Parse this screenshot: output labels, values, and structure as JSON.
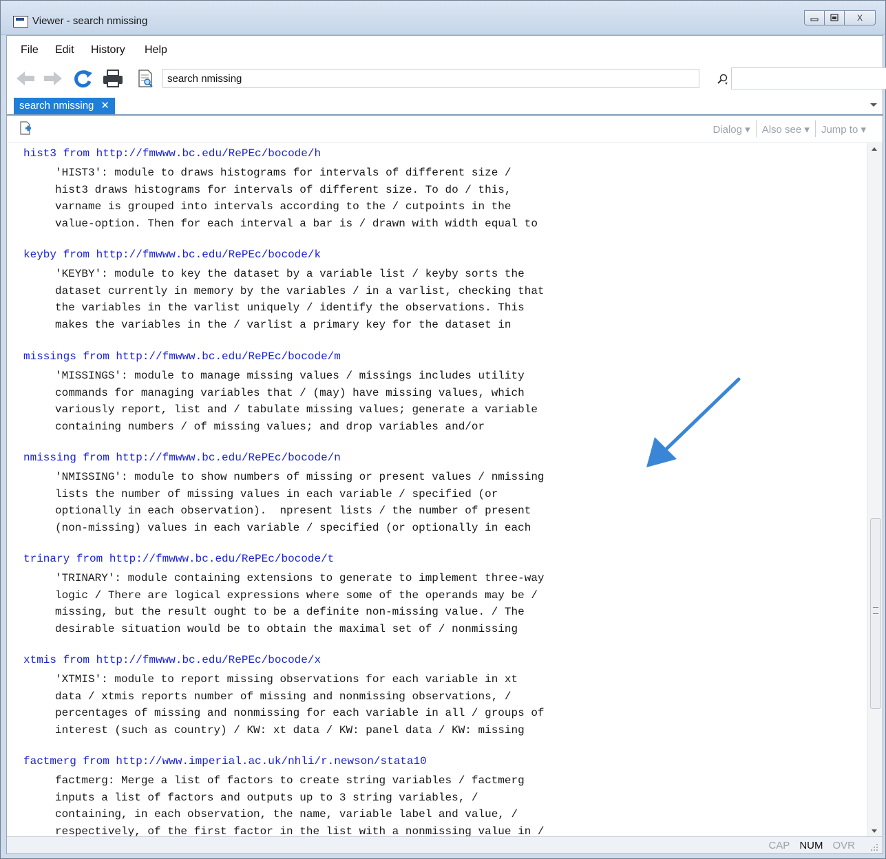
{
  "window": {
    "title": "Viewer - search nmissing",
    "min_symbol": "▭",
    "max_symbol": "▫",
    "close_symbol": "X"
  },
  "menu": [
    "File",
    "Edit",
    "History",
    "Help"
  ],
  "toolbar": {
    "address": "search nmissing"
  },
  "tab": {
    "label": "search nmissing",
    "close": "✕"
  },
  "subnav": {
    "dialog": "Dialog",
    "also_see": "Also see",
    "jump_to": "Jump to"
  },
  "results": [
    {
      "head": "hist3 from http://fmwww.bc.edu/RePEc/bocode/h",
      "lines": [
        "'HIST3': module to draws histograms for intervals of different size /",
        "hist3 draws histograms for intervals of different size. To do / this,",
        "varname is grouped into intervals according to the / cutpoints in the",
        "value-option. Then for each interval a bar is / drawn with width equal to"
      ]
    },
    {
      "head": "keyby from http://fmwww.bc.edu/RePEc/bocode/k",
      "lines": [
        "'KEYBY': module to key the dataset by a variable list / keyby sorts the",
        "dataset currently in memory by the variables / in a varlist, checking that",
        "the variables in the varlist uniquely / identify the observations. This",
        "makes the variables in the / varlist a primary key for the dataset in"
      ]
    },
    {
      "head": "missings from http://fmwww.bc.edu/RePEc/bocode/m",
      "lines": [
        "'MISSINGS': module to manage missing values / missings includes utility",
        "commands for managing variables that / (may) have missing values, which",
        "variously report, list and / tabulate missing values; generate a variable",
        "containing numbers / of missing values; and drop variables and/or"
      ]
    },
    {
      "head": "nmissing from http://fmwww.bc.edu/RePEc/bocode/n",
      "lines": [
        "'NMISSING': module to show numbers of missing or present values / nmissing",
        "lists the number of missing values in each variable / specified (or",
        "optionally in each observation).  npresent lists / the number of present",
        "(non-missing) values in each variable / specified (or optionally in each"
      ]
    },
    {
      "head": "trinary from http://fmwww.bc.edu/RePEc/bocode/t",
      "lines": [
        "'TRINARY': module containing extensions to generate to implement three-way",
        "logic / There are logical expressions where some of the operands may be /",
        "missing, but the result ought to be a definite non-missing value. / The",
        "desirable situation would be to obtain the maximal set of / nonmissing"
      ]
    },
    {
      "head": "xtmis from http://fmwww.bc.edu/RePEc/bocode/x",
      "lines": [
        "'XTMIS': module to report missing observations for each variable in xt",
        "data / xtmis reports number of missing and nonmissing observations, /",
        "percentages of missing and nonmissing for each variable in all / groups of",
        "interest (such as country) / KW: xt data / KW: panel data / KW: missing"
      ]
    },
    {
      "head": "factmerg from http://www.imperial.ac.uk/nhli/r.newson/stata10",
      "lines": [
        "factmerg: Merge a list of factors to create string variables / factmerg",
        "inputs a list of factors and outputs up to 3 string variables, /",
        "containing, in each observation, the name, variable label and value, /",
        "respectively, of the first factor in the list with a nonmissing value in /"
      ]
    }
  ],
  "status": {
    "cap": "CAP",
    "num": "NUM",
    "ovr": "OVR"
  },
  "colors": {
    "link": "#1a23d6",
    "tab_active": "#1f7fd8",
    "annotation_arrow": "#3a86d6"
  }
}
